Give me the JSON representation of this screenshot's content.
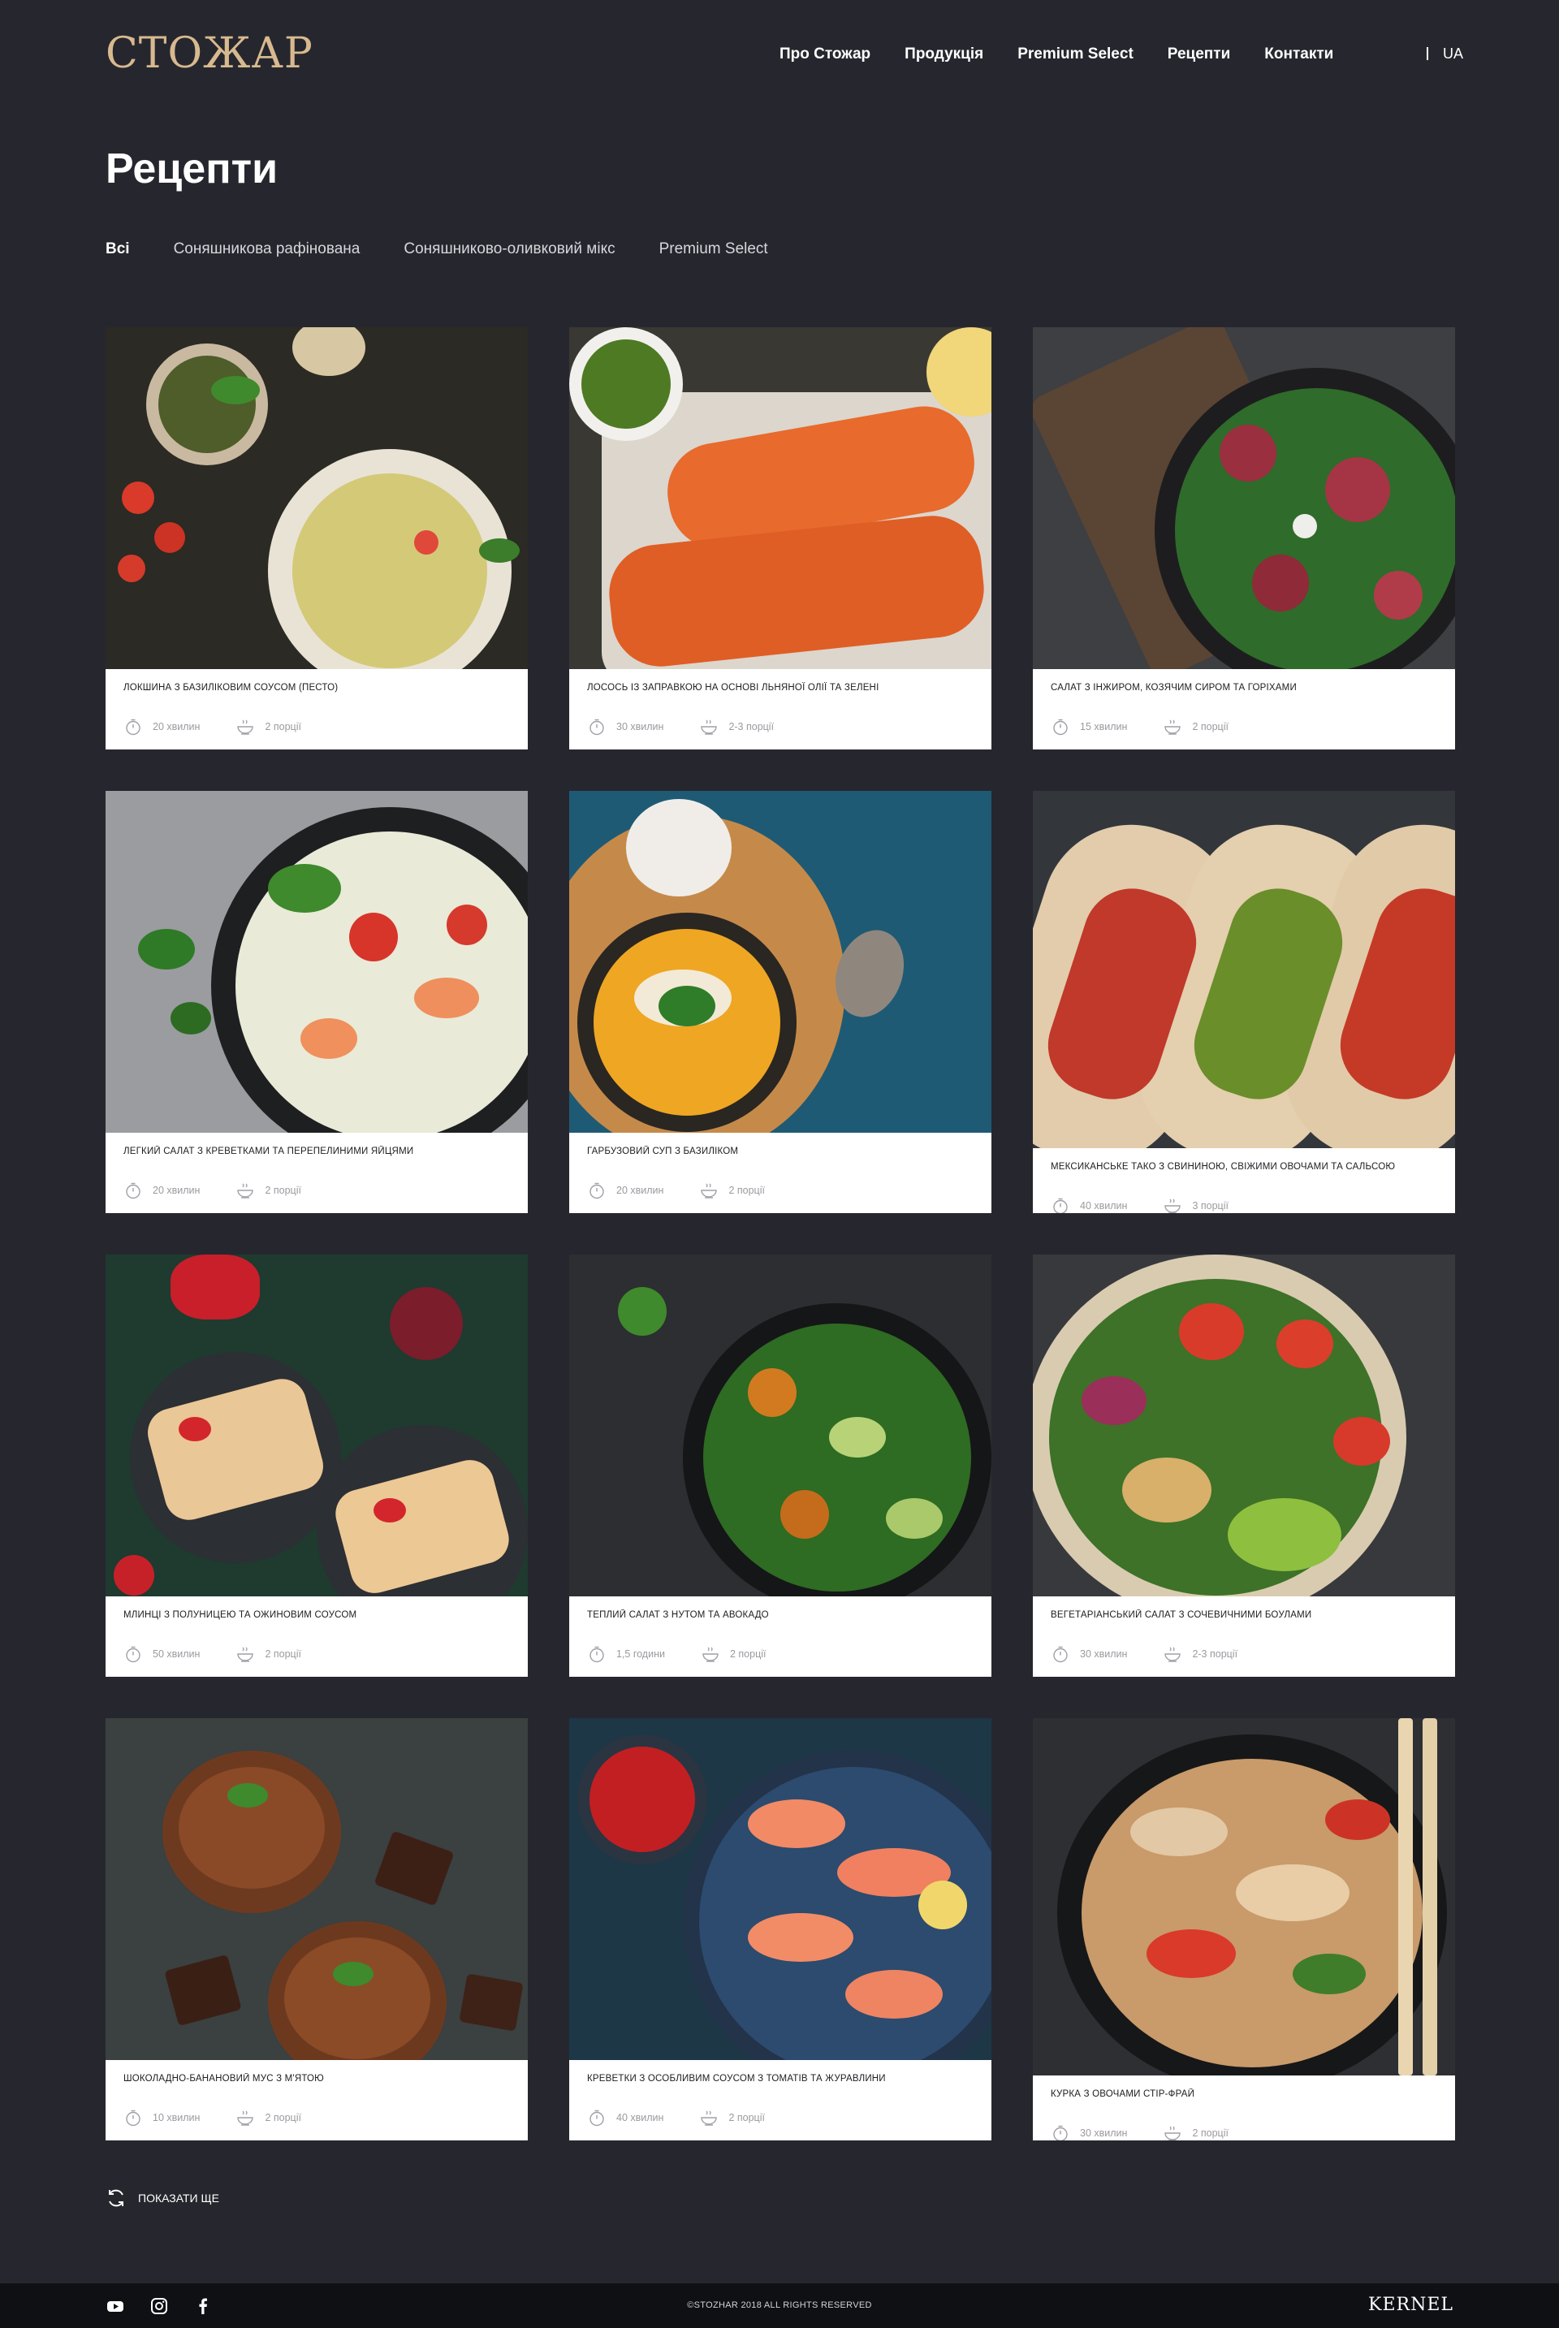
{
  "header": {
    "logo": "СТОЖАР",
    "nav": [
      "Про Стожар",
      "Продукція",
      "Premium Select",
      "Рецепти",
      "Контакти"
    ],
    "lang": "UA"
  },
  "page": {
    "title": "Рецепти"
  },
  "filters": [
    "Всі",
    "Соняшникова рафінована",
    "Соняшниково-оливковий мікс",
    "Premium Select"
  ],
  "recipes": [
    {
      "title": "Локшина з базиліковим соусом (песто)",
      "time": "20 хвилин",
      "servings": "2 порції"
    },
    {
      "title": "Лосось із заправкою на основі льняної олії та зелені",
      "time": "30 хвилин",
      "servings": "2-3 порції"
    },
    {
      "title": "Салат з інжиром, козячим сиром та горіхами",
      "time": "15 хвилин",
      "servings": "2 порції"
    },
    {
      "title": "Легкий салат з креветками та перепелиними яйцями",
      "time": "20 хвилин",
      "servings": "2 порції"
    },
    {
      "title": "Гарбузовий суп з базиліком",
      "time": "20 хвилин",
      "servings": "2 порції"
    },
    {
      "title": "Мексиканське тако з свининою, свіжими овочами та сальсою",
      "time": "40 хвилин",
      "servings": "3 порції"
    },
    {
      "title": "Млинці з полуницею та ожиновим соусом",
      "time": "50 хвилин",
      "servings": "2 порції"
    },
    {
      "title": "Теплий салат з нутом та авокадо",
      "time": "1,5 години",
      "servings": "2 порції"
    },
    {
      "title": "Вегетаріанський салат з сочевичними боулами",
      "time": "30 хвилин",
      "servings": "2-3 порції"
    },
    {
      "title": "Шоколадно-банановий мус з м'ятою",
      "time": "10 хвилин",
      "servings": "2 порції"
    },
    {
      "title": "Креветки з особливим соусом з томатів та журавлини",
      "time": "40 хвилин",
      "servings": "2 порції"
    },
    {
      "title": "Курка з овочами стір-фрай",
      "time": "30 хвилин",
      "servings": "2 порції"
    }
  ],
  "show_more": "Показати ще",
  "footer": {
    "copyright": "©STOZHAR 2018 ALL RIGHTS RESERVED",
    "brand": "KERNEL",
    "social_icons": [
      "youtube-icon",
      "instagram-icon",
      "facebook-icon"
    ]
  },
  "colors": {
    "background": "#26272e",
    "logo": "#d8b98f",
    "footer": "#0f1013"
  }
}
